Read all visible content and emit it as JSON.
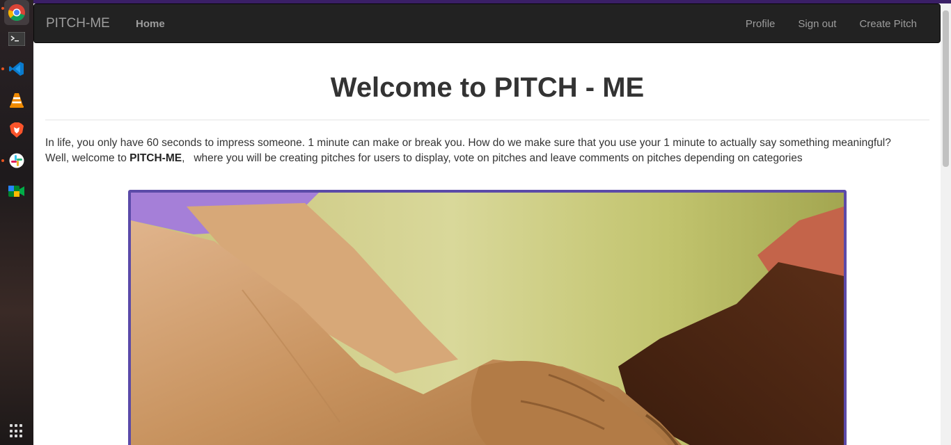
{
  "navbar": {
    "brand": "PITCH-ME",
    "home": "Home",
    "links": [
      "Profile",
      "Sign out",
      "Create Pitch"
    ]
  },
  "welcome": {
    "prefix": "Welcome to ",
    "name": "PITCH - ME"
  },
  "intro": {
    "line1": "In life, you only have 60 seconds to impress someone. 1 minute can make or break you. How do we make sure that you use your 1 minute to actually say something meaningful?",
    "line2_prefix": "Well, welcome to ",
    "line2_brand": "PITCH-ME",
    "line2_suffix": ",   where you will be creating pitches for users to display, vote on pitches and leave comments on pitches depending on categories"
  },
  "dock": {
    "apps": [
      "chrome-icon",
      "terminal-icon",
      "vscode-icon",
      "vlc-icon",
      "brave-icon",
      "slack-icon",
      "meet-icon"
    ]
  },
  "colors": {
    "navbar_bg": "#222222",
    "nav_text": "#9d9d9d",
    "photo_border": "#5b4aa8",
    "top_strip": "#3a1f66"
  }
}
